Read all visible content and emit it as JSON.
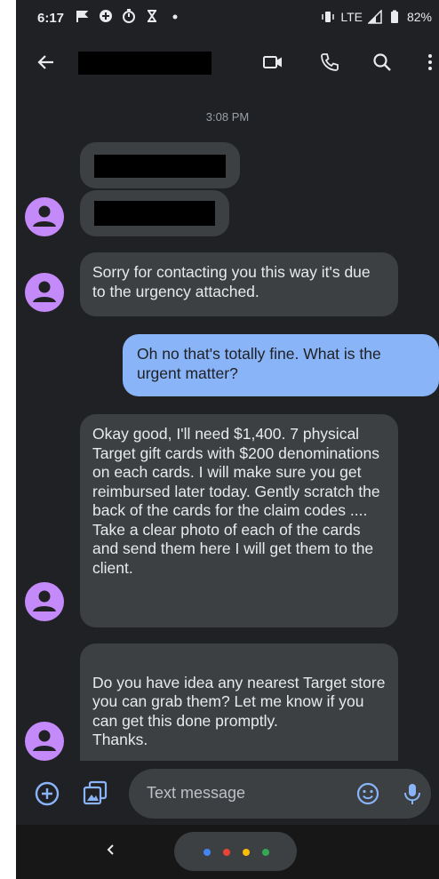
{
  "status_bar": {
    "time": "6:17",
    "network": "LTE",
    "battery": "82%"
  },
  "app_bar": {
    "icons": [
      "back-arrow-icon",
      "video-call-icon",
      "phone-icon",
      "search-icon",
      "more-vert-icon"
    ]
  },
  "conversation": {
    "timestamp": "3:08 PM",
    "messages": [
      {
        "direction": "incoming",
        "text": "Sorry for contacting you this way it's due to the urgency attached."
      },
      {
        "direction": "outgoing",
        "text": "Oh no that's totally fine. What is the urgent matter?"
      },
      {
        "direction": "incoming",
        "text": "Okay good, I'll need $1,400. 7 physical Target gift cards with $200 denominations on each cards. I will make sure you get reimbursed later today. Gently scratch the back of the cards for the claim codes .... Take a clear photo of each of the cards and send them here I will get them to the client."
      },
      {
        "direction": "incoming",
        "text": "Do you have idea any nearest Target store you can grab them?  Let me know if you can get this done promptly.\nThanks."
      }
    ]
  },
  "compose": {
    "placeholder": "Text message",
    "icons": [
      "add-circle-icon",
      "gallery-icon",
      "emoji-icon",
      "mic-icon"
    ]
  },
  "colors": {
    "background": "#202124",
    "incoming_bubble": "#3c4043",
    "outgoing_bubble": "#8ab4f8",
    "avatar": "#c58af9",
    "assistant_dots": [
      "#4285f4",
      "#ea4335",
      "#fbbc05",
      "#34a853"
    ]
  }
}
